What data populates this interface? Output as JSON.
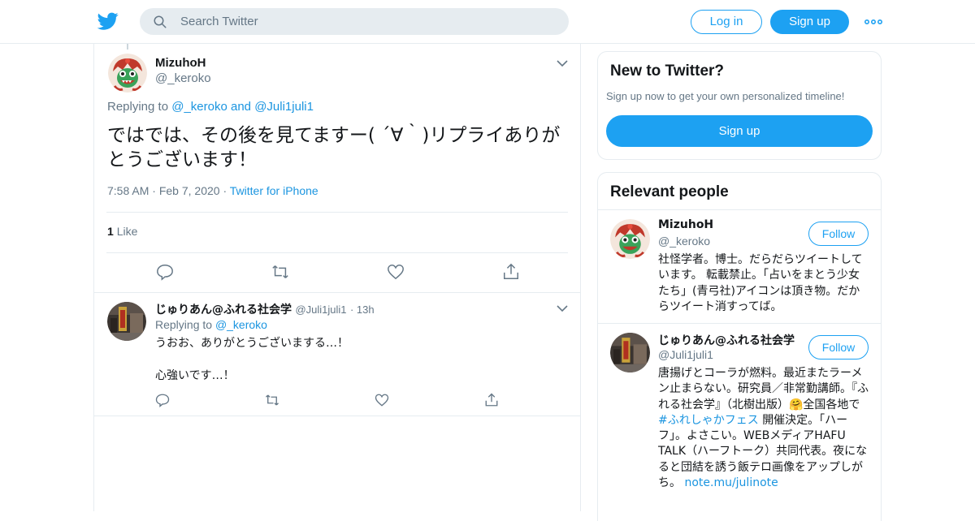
{
  "header": {
    "search_placeholder": "Search Twitter",
    "login_label": "Log in",
    "signup_label": "Sign up",
    "brand_color": "#1da1f2"
  },
  "main_tweet": {
    "name": "MizuhoH",
    "handle": "@_keroko",
    "replying_prefix": "Replying to",
    "replying_to_1": "@_keroko",
    "replying_and": "and",
    "replying_to_2": "@Juli1juli1",
    "text": "ではでは、その後を見てますー( ´∀｀)リプライありがとうございます！",
    "time": "7:58 AM",
    "date": "Feb 7, 2020",
    "source": "Twitter for iPhone",
    "like_count": "1",
    "like_label": "Like"
  },
  "reply": {
    "name": "じゅりあん@ふれる社会学",
    "handle": "@Juli1juli1",
    "age": "13h",
    "replying_prefix": "Replying to",
    "replying_to": "@_keroko",
    "text": "うおお、ありがとうございまする…！\n\n心強いです…！"
  },
  "new_to_twitter": {
    "title": "New to Twitter?",
    "subtitle": "Sign up now to get your own personalized timeline!",
    "button": "Sign up"
  },
  "relevant": {
    "title": "Relevant people",
    "follow_label": "Follow",
    "people": [
      {
        "name": "MizuhoH",
        "handle": "@_keroko",
        "bio": "社怪学者。博士。だらだらツイートしています。 転載禁止。「占いをまとう少女たち」(青弓社)アイコンは頂き物。だからツイート消すってば。"
      },
      {
        "name": "じゅりあん@ふれる社会学",
        "handle": "@Juli1juli1",
        "bio_1": "唐揚げとコーラが燃料。最近またラーメン止まらない。研究員／非常勤講師。『ふれる社会学』（北樹出版）🤗全国各地で",
        "bio_hashtag": "#ふれしゃかフェス",
        "bio_2": "開催決定。「ハーフ」。よさこい。WEBメディアHAFU TALK（ハーフトーク）共同代表。夜になると団結を誘う飯テロ画像をアップしがち。",
        "bio_link": "note.mu/julinote"
      }
    ]
  }
}
